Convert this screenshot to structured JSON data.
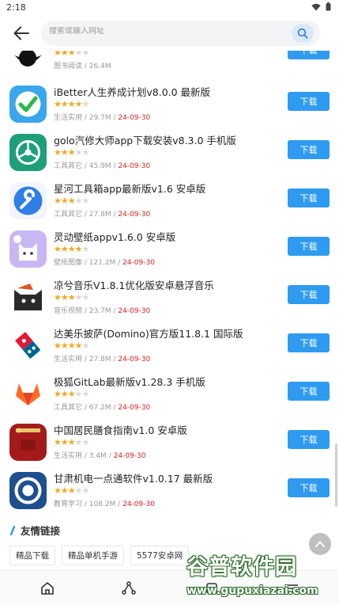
{
  "status": {
    "time": "2:18"
  },
  "search": {
    "placeholder": "搜索或输入网址"
  },
  "apps": [
    {
      "name": "",
      "stars": 3,
      "category": "图书阅读",
      "size": "26.4M",
      "date": "",
      "download_label": "下载",
      "icon": "book-reader-icon"
    },
    {
      "name": "iBetter人生养成计划v8.0.0 最新版",
      "stars": 4,
      "category": "生活实用",
      "size": "29.7M",
      "date": "24-09-30",
      "download_label": "下载",
      "icon": "checkmark-icon"
    },
    {
      "name": "golo汽修大师app下载安装v8.3.0 手机版",
      "stars": 3,
      "category": "工具其它",
      "size": "45.9M",
      "date": "24-09-30",
      "download_label": "下载",
      "icon": "steering-wheel-icon"
    },
    {
      "name": "星河工具箱app最新版v1.6 安卓版",
      "stars": 3,
      "category": "工具其它",
      "size": "27.8M",
      "date": "24-09-30",
      "download_label": "下载",
      "icon": "wrench-icon"
    },
    {
      "name": "灵动壁纸appv1.6.0 安卓版",
      "stars": 4,
      "category": "壁纸图像",
      "size": "121.2M",
      "date": "24-09-30",
      "download_label": "下载",
      "icon": "cat-icon"
    },
    {
      "name": "凉兮音乐V1.8.1优化版安卓悬浮音乐",
      "stars": 3,
      "category": "音乐视频",
      "size": "23.7M",
      "date": "24-09-30",
      "download_label": "下载",
      "icon": "cartoon-cat-icon"
    },
    {
      "name": "达美乐披萨(Domino)官方版11.8.1 国际版",
      "stars": 4,
      "category": "生活实用",
      "size": "27.8M",
      "date": "24-09-30",
      "download_label": "下载",
      "icon": "domino-icon"
    },
    {
      "name": "极狐GitLab最新版v1.28.3 手机版",
      "stars": 3,
      "category": "工具其它",
      "size": "67.2M",
      "date": "24-09-30",
      "download_label": "下载",
      "icon": "fox-icon"
    },
    {
      "name": "中国居民膳食指南v1.0 安卓版",
      "stars": 3,
      "category": "生活实用",
      "size": "3.4M",
      "date": "24-09-30",
      "download_label": "下载",
      "icon": "book-cover-icon"
    },
    {
      "name": "甘肃机电一点通软件v1.0.17 最新版",
      "stars": 3,
      "category": "教育学习",
      "size": "108.2M",
      "date": "24-09-30",
      "download_label": "下载",
      "icon": "school-emblem-icon"
    }
  ],
  "links": {
    "title": "友情链接",
    "items": [
      "精品下载",
      "精品单机手游",
      "5577安卓网"
    ]
  },
  "watermark": {
    "brand": "谷普软件园",
    "url": "www.gupuxiazai.com"
  },
  "colors": {
    "accent": "#2f9bf0",
    "date": "#e02020",
    "star": "#f5a623"
  }
}
